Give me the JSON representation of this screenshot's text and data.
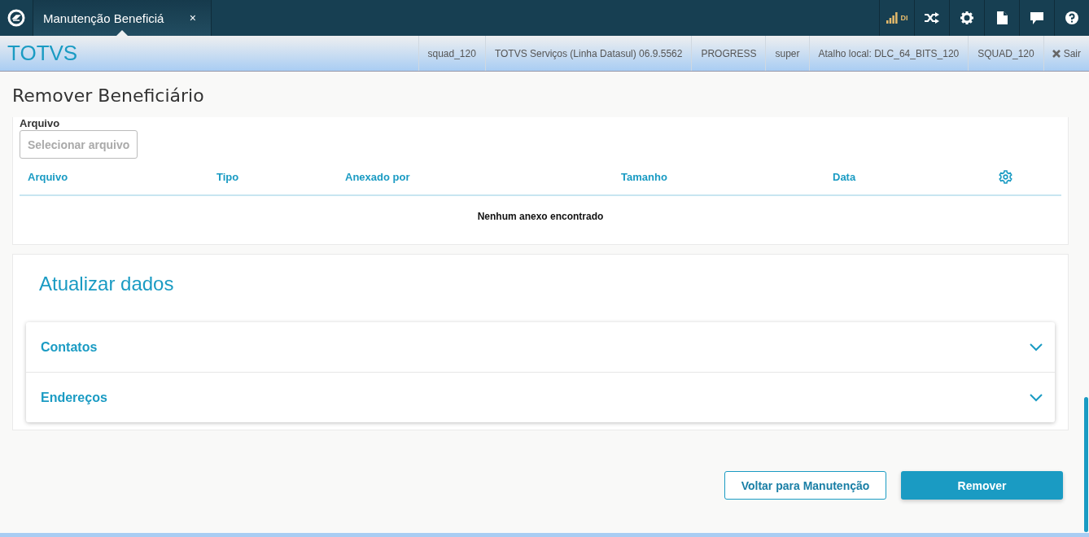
{
  "tabs": [
    {
      "label": "Manutenção Beneficiá",
      "selected": true,
      "close": "×"
    }
  ],
  "toolbar": {
    "signal_label": "DI",
    "icons": [
      {
        "kind": "shuffle"
      },
      {
        "kind": "settings"
      },
      {
        "kind": "document"
      },
      {
        "kind": "chat"
      },
      {
        "kind": "help"
      }
    ]
  },
  "brand": "TOTVS",
  "info_bar": [
    "squad_120",
    "TOTVS Serviços (Linha Datasul) 06.9.5562",
    "PROGRESS",
    "super",
    "Atalho local: DLC_64_BITS_120",
    "SQUAD_120"
  ],
  "logout": "Sair",
  "page_title": "Remover Beneficiário",
  "attachments": {
    "label": "Arquivo",
    "select_button": "Selecionar arquivo",
    "columns": [
      "Arquivo",
      "Tipo",
      "Anexado por",
      "Tamanho",
      "Data"
    ],
    "empty_message": "Nenhum anexo encontrado"
  },
  "update_section": {
    "title": "Atualizar dados",
    "items": [
      {
        "label": "Contatos",
        "expanded": false
      },
      {
        "label": "Endereços",
        "expanded": false
      }
    ]
  },
  "buttons": [
    {
      "label": "Voltar para Manutenção",
      "kind": "secondary"
    },
    {
      "label": "Remover",
      "kind": "primary"
    }
  ]
}
